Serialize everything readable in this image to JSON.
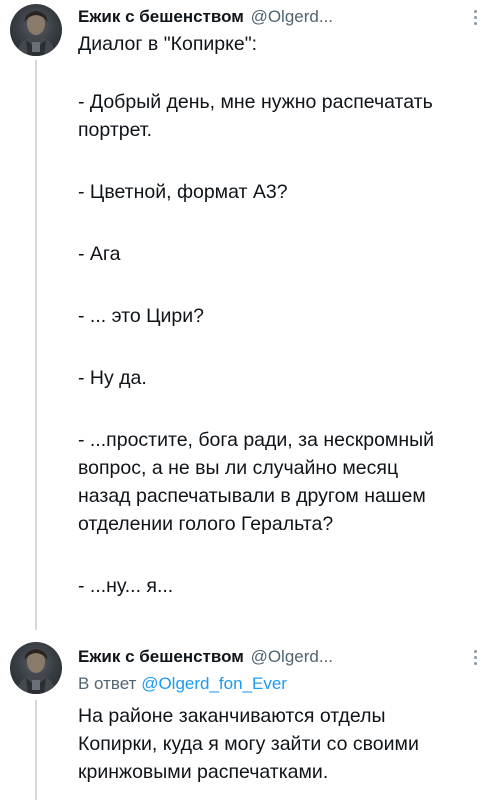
{
  "tweets": [
    {
      "author_name": "Ежик с бешенством",
      "author_handle": "@Olgerd...",
      "lines": [
        "Диалог в \"Копирке\":",
        "- Добрый день, мне нужно распечатать",
        "портрет.",
        "- Цветной, формат А3?",
        "- Ага",
        "- ... это Цири?",
        "- Ну да.",
        "- ...простите, бога ради, за нескромный",
        "вопрос, а не вы ли случайно месяц",
        "назад распечатывали в другом нашем",
        "отделении голого Геральта?",
        "- ...ну... я..."
      ]
    },
    {
      "author_name": "Ежик с бешенством",
      "author_handle": "@Olgerd...",
      "reply_prefix": "В ответ",
      "reply_handle": "@Olgerd_fon_Ever",
      "lines": [
        "На районе заканчиваются отделы",
        "Копирки, куда я могу зайти со своими",
        "кринжовыми распечатками."
      ]
    }
  ],
  "icons": {
    "avatar": "avatar-image",
    "more": "more-options-icon"
  },
  "colors": {
    "text": "#0f1419",
    "secondary": "#536471",
    "link": "#1d9bf0",
    "thread_line": "#cfd9de"
  }
}
